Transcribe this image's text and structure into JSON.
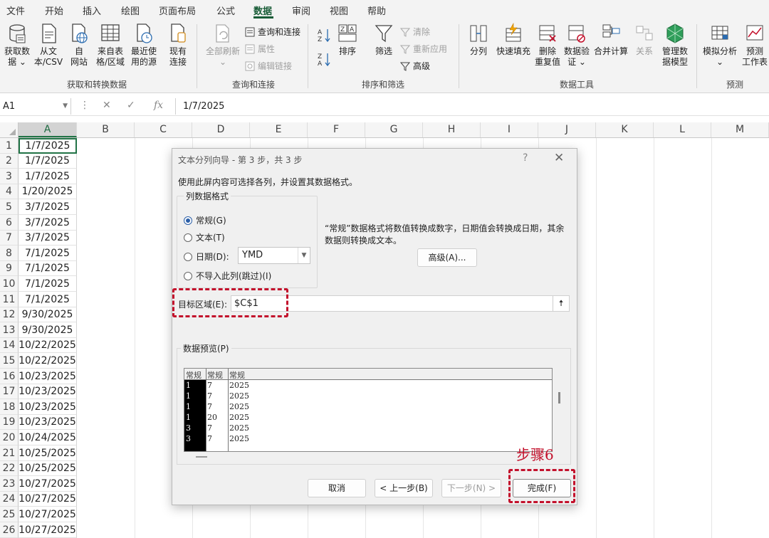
{
  "menu": {
    "tabs": [
      "文件",
      "开始",
      "插入",
      "绘图",
      "页面布局",
      "公式",
      "数据",
      "审阅",
      "视图",
      "帮助"
    ],
    "active_tab": "数据"
  },
  "ribbon": {
    "get_data": {
      "label": "获取和转换数据",
      "buttons": [
        {
          "l1": "获取数",
          "l2": "据 ⌄",
          "icon": "database-icon"
        },
        {
          "l1": "从文",
          "l2": "本/CSV",
          "icon": "text-file-icon"
        },
        {
          "l1": "自",
          "l2": "网站",
          "icon": "web-page-icon"
        },
        {
          "l1": "来自表",
          "l2": "格/区域",
          "icon": "table-icon"
        },
        {
          "l1": "最近使",
          "l2": "用的源",
          "icon": "recent-source-icon"
        },
        {
          "l1": "现有",
          "l2": "连接",
          "icon": "existing-connections-icon"
        }
      ]
    },
    "queries": {
      "label": "查询和连接",
      "refresh": {
        "l1": "全部刷新",
        "l2": "⌄"
      },
      "items": [
        "查询和连接",
        "属性",
        "编辑链接"
      ]
    },
    "sort_filter": {
      "label": "排序和筛选",
      "sort": "排序",
      "filter": "筛选",
      "items": [
        "清除",
        "重新应用",
        "高级"
      ]
    },
    "data_tools": {
      "label": "数据工具",
      "buttons": [
        {
          "l1": "分列",
          "l2": ""
        },
        {
          "l1": "快速填充",
          "l2": ""
        },
        {
          "l1": "删除",
          "l2": "重复值"
        },
        {
          "l1": "数据验",
          "l2": "证 ⌄"
        },
        {
          "l1": "合并计算",
          "l2": ""
        },
        {
          "l1": "关系",
          "l2": ""
        },
        {
          "l1": "管理数",
          "l2": "据模型"
        }
      ]
    },
    "forecast": {
      "label": "预测",
      "buttons": [
        {
          "l1": "模拟分析",
          "l2": "⌄"
        },
        {
          "l1": "预测",
          "l2": "工作表"
        }
      ]
    }
  },
  "formula_bar": {
    "name_box": "A1",
    "fx": "fx",
    "value": "1/7/2025"
  },
  "grid": {
    "columns": [
      "A",
      "B",
      "C",
      "D",
      "E",
      "F",
      "G",
      "H",
      "I",
      "J",
      "K",
      "L",
      "M"
    ],
    "rows": [
      {
        "n": "1",
        "a": "1/7/2025"
      },
      {
        "n": "2",
        "a": "1/7/2025"
      },
      {
        "n": "3",
        "a": "1/7/2025"
      },
      {
        "n": "4",
        "a": "1/20/2025"
      },
      {
        "n": "5",
        "a": "3/7/2025"
      },
      {
        "n": "6",
        "a": "3/7/2025"
      },
      {
        "n": "7",
        "a": "3/7/2025"
      },
      {
        "n": "8",
        "a": "7/1/2025"
      },
      {
        "n": "9",
        "a": "7/1/2025"
      },
      {
        "n": "10",
        "a": "7/1/2025"
      },
      {
        "n": "11",
        "a": "7/1/2025"
      },
      {
        "n": "12",
        "a": "9/30/2025"
      },
      {
        "n": "13",
        "a": "9/30/2025"
      },
      {
        "n": "14",
        "a": "10/22/2025"
      },
      {
        "n": "15",
        "a": "10/22/2025"
      },
      {
        "n": "16",
        "a": "10/23/2025"
      },
      {
        "n": "17",
        "a": "10/23/2025"
      },
      {
        "n": "18",
        "a": "10/23/2025"
      },
      {
        "n": "19",
        "a": "10/23/2025"
      },
      {
        "n": "20",
        "a": "10/24/2025"
      },
      {
        "n": "21",
        "a": "10/25/2025"
      },
      {
        "n": "22",
        "a": "10/25/2025"
      },
      {
        "n": "23",
        "a": "10/27/2025"
      },
      {
        "n": "24",
        "a": "10/27/2025"
      },
      {
        "n": "25",
        "a": "10/27/2025"
      },
      {
        "n": "26",
        "a": "10/27/2025"
      }
    ]
  },
  "dialog": {
    "title": "文本分列向导 - 第 3 步，共 3 步",
    "help": "?",
    "close": "✕",
    "instruction": "使用此屏内容可选择各列，并设置其数据格式。",
    "format_group": "列数据格式",
    "radios": [
      {
        "label": "常规(G)",
        "checked": true
      },
      {
        "label": "文本(T)",
        "checked": false
      },
      {
        "label": "日期(D):",
        "checked": false
      },
      {
        "label": "不导入此列(跳过)(I)",
        "checked": false
      }
    ],
    "date_format": "YMD",
    "description": "“常规”数据格式将数值转换成数字，日期值会转换成日期，其余数据则转换成文本。",
    "advanced_button": "高级(A)...",
    "target_label": "目标区域(E):",
    "target_value": "$C$1",
    "collapse_icon": "🠅",
    "preview_label": "数据预览(P)",
    "preview_headers": [
      "常规",
      "常规",
      "常规"
    ],
    "preview_rows": [
      [
        "1",
        "7",
        "2025"
      ],
      [
        "1",
        "7",
        "2025"
      ],
      [
        "1",
        "7",
        "2025"
      ],
      [
        "1",
        "20",
        "2025"
      ],
      [
        "3",
        "7",
        "2025"
      ],
      [
        "3",
        "7",
        "2025"
      ]
    ],
    "buttons": {
      "cancel": "取消",
      "back": "< 上一步(B)",
      "next": "下一步(N) >",
      "finish": "完成(F)"
    }
  },
  "annotation": {
    "step_label": "步骤6",
    "color": "#c3112c"
  }
}
